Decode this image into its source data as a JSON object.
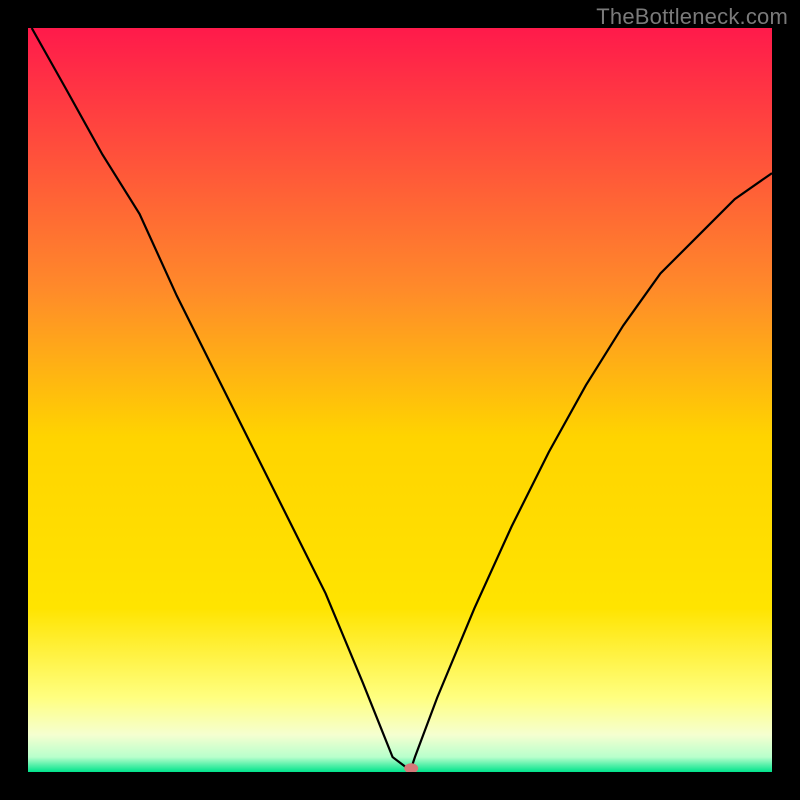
{
  "watermark": "TheBottleneck.com",
  "chart_data": {
    "type": "line",
    "title": "",
    "xlabel": "",
    "ylabel": "",
    "xlim": [
      0,
      100
    ],
    "ylim": [
      0,
      100
    ],
    "background_gradient": {
      "top": "#ff1a4b",
      "mid_upper": "#ffa030",
      "mid": "#ffd400",
      "mid_lower": "#ffff70",
      "near_bottom": "#e6ffcc",
      "bottom": "#00e38c"
    },
    "series": [
      {
        "name": "bottleneck-curve",
        "x": [
          0.5,
          5,
          10,
          15,
          20,
          25,
          30,
          35,
          40,
          45,
          49,
          51,
          51.5,
          52,
          55,
          60,
          65,
          70,
          75,
          80,
          85,
          90,
          95,
          100
        ],
        "y": [
          100,
          92,
          83,
          75,
          64,
          54,
          44,
          34,
          24,
          12,
          2,
          0.5,
          0.5,
          2,
          10,
          22,
          33,
          43,
          52,
          60,
          67,
          72,
          77,
          80.5
        ],
        "stroke": "#000000",
        "stroke_width": 2.2
      }
    ],
    "marker": {
      "name": "bottleneck-point",
      "x": 51.5,
      "y": 0.5,
      "rx": 7,
      "ry": 5,
      "fill": "#d47a7a"
    }
  }
}
